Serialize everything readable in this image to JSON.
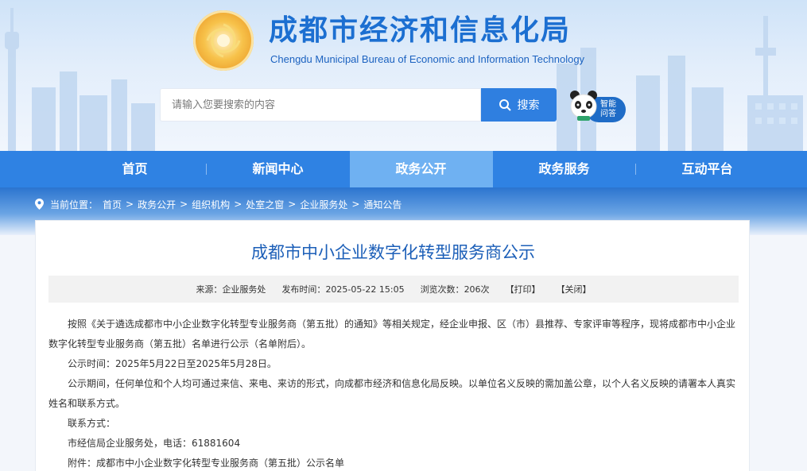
{
  "header": {
    "title": "成都市经济和信息化局",
    "subtitle": "Chengdu Municipal Bureau of Economic and Information Technology"
  },
  "search": {
    "placeholder": "请输入您要搜索的内容",
    "button_label": "搜索"
  },
  "assistant": {
    "label_line1": "智能",
    "label_line2": "问答"
  },
  "nav": {
    "items": [
      {
        "label": "首页"
      },
      {
        "label": "新闻中心"
      },
      {
        "label": "政务公开"
      },
      {
        "label": "政务服务"
      },
      {
        "label": "互动平台"
      }
    ],
    "active_index": 2
  },
  "breadcrumb": {
    "prefix": "当前位置：",
    "items": [
      "首页",
      "政务公开",
      "组织机构",
      "处室之窗",
      "企业服务处",
      "通知公告"
    ],
    "separator": ">"
  },
  "article": {
    "title": "成都市中小企业数字化转型服务商公示",
    "meta": {
      "source_label": "来源：",
      "source": "企业服务处",
      "date_label": "发布时间：",
      "date": "2025-05-22 15:05",
      "views_label": "浏览次数：",
      "views": "206次",
      "print": "【打印】",
      "close": "【关闭】"
    },
    "paragraphs": [
      "按照《关于遴选成都市中小企业数字化转型专业服务商（第五批）的通知》等相关规定，经企业申报、区（市）县推荐、专家评审等程序，现将成都市中小企业数字化转型专业服务商（第五批）名单进行公示（名单附后）。",
      "公示时间：2025年5月22日至2025年5月28日。",
      "公示期间，任何单位和个人均可通过来信、来电、来访的形式，向成都市经济和信息化局反映。以单位名义反映的需加盖公章，以个人名义反映的请署本人真实姓名和联系方式。",
      "联系方式：",
      "市经信局企业服务处，电话：61881604",
      "附件：成都市中小企业数字化转型专业服务商（第五批）公示名单"
    ]
  },
  "colors": {
    "brand_blue": "#1c6fd1",
    "nav_blue": "#2f82e3",
    "nav_active": "#6fb1f2",
    "title_blue": "#1c5fb8"
  },
  "icons": [
    "location-pin-icon",
    "search-icon",
    "panda-mascot-icon",
    "bureau-logo-icon"
  ]
}
